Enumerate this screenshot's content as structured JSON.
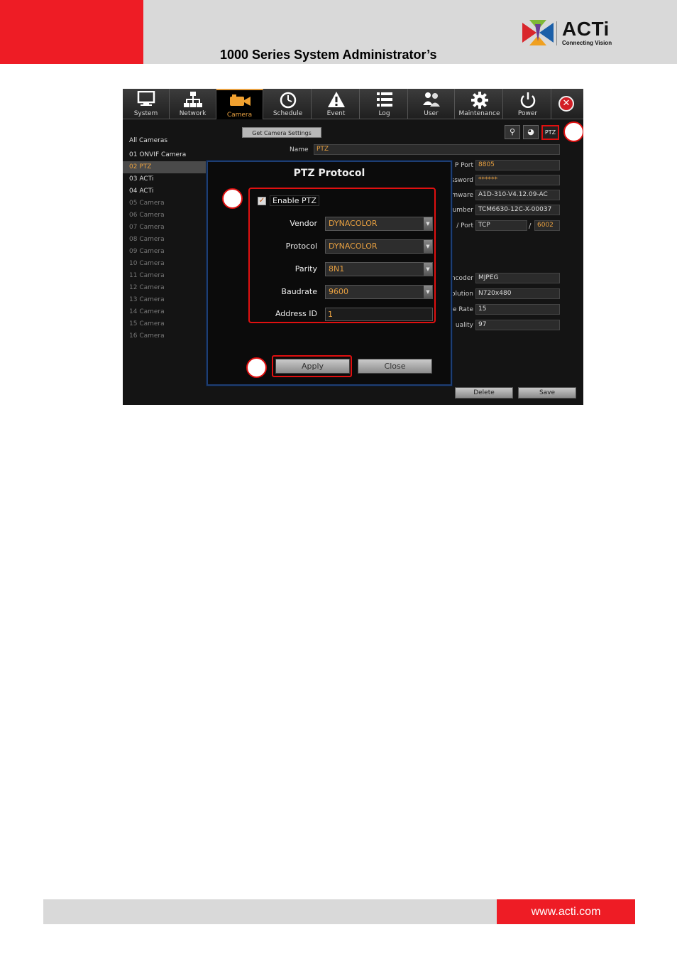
{
  "header": {
    "title": "1000 Series System Administrator’s"
  },
  "logo": {
    "name": "ACTi",
    "tagline": "Connecting Vision"
  },
  "footer": {
    "url": "www.acti.com"
  },
  "app": {
    "tabs": [
      {
        "label": "System",
        "icon": "monitor-icon"
      },
      {
        "label": "Network",
        "icon": "network-icon"
      },
      {
        "label": "Camera",
        "icon": "camera-icon",
        "active": true
      },
      {
        "label": "Schedule",
        "icon": "clock-icon"
      },
      {
        "label": "Event",
        "icon": "warning-icon"
      },
      {
        "label": "Log",
        "icon": "list-icon"
      },
      {
        "label": "User",
        "icon": "users-icon"
      },
      {
        "label": "Maintenance",
        "icon": "gear-icon"
      },
      {
        "label": "Power",
        "icon": "power-icon"
      }
    ],
    "get_settings_label": "Get Camera Settings",
    "ptz_button_label": "PTZ",
    "camera_list_header": "All Cameras",
    "cameras": [
      "01 ONVIF Camera",
      "02 PTZ",
      "03 ACTi",
      "04 ACTi",
      "05 Camera",
      "06 Camera",
      "07 Camera",
      "08 Camera",
      "09 Camera",
      "10 Camera",
      "11 Camera",
      "12 Camera",
      "13 Camera",
      "14 Camera",
      "15 Camera",
      "16 Camera"
    ],
    "selected_camera": "02 PTZ",
    "name_label": "Name",
    "name_value": "PTZ",
    "fields": [
      {
        "label": "P Port",
        "value": "8805"
      },
      {
        "label": "ssword",
        "value": "******"
      },
      {
        "label": "mware",
        "value": "A1D-310-V4.12.09-AC"
      },
      {
        "label": "umber",
        "value": "TCM6630-12C-X-00037"
      },
      {
        "label": "/ Port",
        "value": "TCP",
        "value2": "6002"
      },
      {
        "label": "ncoder",
        "value": "MJPEG"
      },
      {
        "label": "olution",
        "value": "N720x480"
      },
      {
        "label": "e Rate",
        "value": "15"
      },
      {
        "label": "uality",
        "value": "97"
      }
    ],
    "delete_label": "Delete",
    "save_label": "Save"
  },
  "ptz_dialog": {
    "title": "PTZ Protocol",
    "enable_label": "Enable PTZ",
    "enabled": true,
    "vendor_label": "Vendor",
    "vendor_value": "DYNACOLOR",
    "protocol_label": "Protocol",
    "protocol_value": "DYNACOLOR",
    "parity_label": "Parity",
    "parity_value": "8N1",
    "baudrate_label": "Baudrate",
    "baudrate_value": "9600",
    "address_label": "Address ID",
    "address_value": "1",
    "apply_label": "Apply",
    "close_label": "Close"
  }
}
